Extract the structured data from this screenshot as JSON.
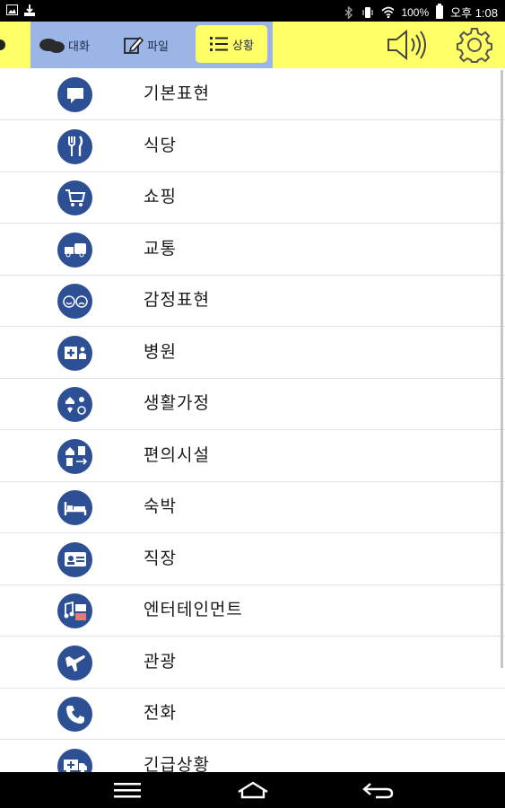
{
  "status": {
    "battery_percent": "100%",
    "time": "오후 1:08"
  },
  "tabs": {
    "talk": "대화",
    "file": "파일",
    "situation": "상황"
  },
  "categories": [
    {
      "label": "기본표현",
      "icon": "speech-bubble-icon"
    },
    {
      "label": "식당",
      "icon": "fork-knife-icon"
    },
    {
      "label": "쇼핑",
      "icon": "shopping-cart-icon"
    },
    {
      "label": "교통",
      "icon": "vehicle-icon"
    },
    {
      "label": "감정표현",
      "icon": "faces-icon"
    },
    {
      "label": "병원",
      "icon": "hospital-icon"
    },
    {
      "label": "생활가정",
      "icon": "home-life-icon"
    },
    {
      "label": "편의시설",
      "icon": "facilities-icon"
    },
    {
      "label": "숙박",
      "icon": "bed-icon"
    },
    {
      "label": "직장",
      "icon": "id-card-icon"
    },
    {
      "label": "엔터테인먼트",
      "icon": "entertainment-icon"
    },
    {
      "label": "관광",
      "icon": "plane-icon"
    },
    {
      "label": "전화",
      "icon": "phone-icon"
    },
    {
      "label": "긴급상황",
      "icon": "emergency-truck-icon"
    }
  ],
  "colors": {
    "header_bg": "#ffff66",
    "tab_group_bg": "#9ab5e6",
    "icon_circle": "#2d4f94"
  }
}
